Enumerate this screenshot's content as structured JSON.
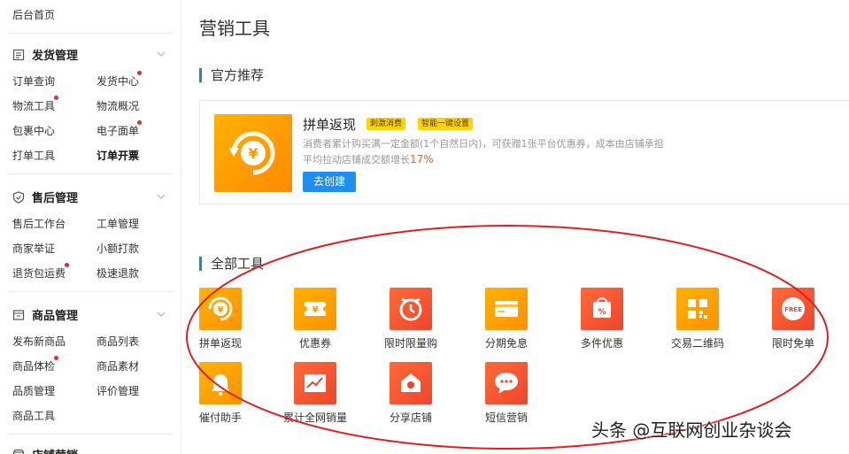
{
  "sidebar": {
    "home": "后台首页",
    "sections": [
      {
        "title": "发货管理",
        "icon": "list-icon",
        "items": [
          {
            "label": "订单查询",
            "dot": false,
            "active": false
          },
          {
            "label": "发货中心",
            "dot": true,
            "active": false
          },
          {
            "label": "物流工具",
            "dot": true,
            "active": false
          },
          {
            "label": "物流概况",
            "dot": false,
            "active": false
          },
          {
            "label": "包裹中心",
            "dot": false,
            "active": false
          },
          {
            "label": "电子面单",
            "dot": true,
            "active": false
          },
          {
            "label": "打单工具",
            "dot": false,
            "active": false
          },
          {
            "label": "订单开票",
            "dot": false,
            "active": true
          }
        ]
      },
      {
        "title": "售后管理",
        "icon": "shield-icon",
        "items": [
          {
            "label": "售后工作台",
            "dot": false,
            "active": false
          },
          {
            "label": "工单管理",
            "dot": false,
            "active": false
          },
          {
            "label": "商家举证",
            "dot": false,
            "active": false
          },
          {
            "label": "小额打款",
            "dot": false,
            "active": false
          },
          {
            "label": "退货包运费",
            "dot": true,
            "active": false
          },
          {
            "label": "极速退款",
            "dot": false,
            "active": false
          }
        ]
      },
      {
        "title": "商品管理",
        "icon": "box-icon",
        "items": [
          {
            "label": "发布新商品",
            "dot": false,
            "active": false
          },
          {
            "label": "商品列表",
            "dot": false,
            "active": false
          },
          {
            "label": "商品体检",
            "dot": true,
            "active": false
          },
          {
            "label": "商品素材",
            "dot": false,
            "active": false
          },
          {
            "label": "品质管理",
            "dot": false,
            "active": false
          },
          {
            "label": "评价管理",
            "dot": false,
            "active": false
          },
          {
            "label": "商品工具",
            "dot": false,
            "active": false
          }
        ]
      },
      {
        "title": "店铺营销",
        "icon": "store-icon",
        "items": []
      }
    ]
  },
  "main": {
    "page_title": "营销工具",
    "recommend_title": "官方推荐",
    "recommend": {
      "name": "拼单返现",
      "tags": [
        "刺激消费",
        "智能一键设置"
      ],
      "desc_line1": "消费者累计购买满一定金额(1个自然日内)，可获赠1张平台优惠券，成本由店铺承担",
      "desc_line2_prefix": "平均拉动店铺成交额增长",
      "desc_line2_highlight": "17%",
      "button": "去创建"
    },
    "all_tools_title": "全部工具",
    "tools": [
      {
        "label": "拼单返现",
        "icon": "yuan-cycle-icon",
        "color": "orange"
      },
      {
        "label": "优惠券",
        "icon": "coupon-icon",
        "color": "orange"
      },
      {
        "label": "限时限量购",
        "icon": "alarm-clock-icon",
        "color": "red"
      },
      {
        "label": "分期免息",
        "icon": "credit-card-icon",
        "color": "orange"
      },
      {
        "label": "多件优惠",
        "icon": "discount-bag-icon",
        "color": "red"
      },
      {
        "label": "交易二维码",
        "icon": "qr-code-icon",
        "color": "orange"
      },
      {
        "label": "限时免单",
        "icon": "free-badge-icon",
        "color": "red"
      },
      {
        "label": "催付助手",
        "icon": "bell-icon",
        "color": "orange"
      },
      {
        "label": "累计全网销量",
        "icon": "trend-chart-icon",
        "color": "red"
      },
      {
        "label": "分享店铺",
        "icon": "share-store-icon",
        "color": "red"
      },
      {
        "label": "短信营销",
        "icon": "sms-bubble-icon",
        "color": "red"
      }
    ],
    "free_badge_text": "FREE"
  },
  "watermark": "头条 @互联网创业杂谈会",
  "colors": {
    "accent_blue": "#1e8ff0",
    "orange": "#ffa500",
    "red": "#f0452a",
    "annotation_red": "#e02020",
    "highlight": "#ff5a1f"
  }
}
